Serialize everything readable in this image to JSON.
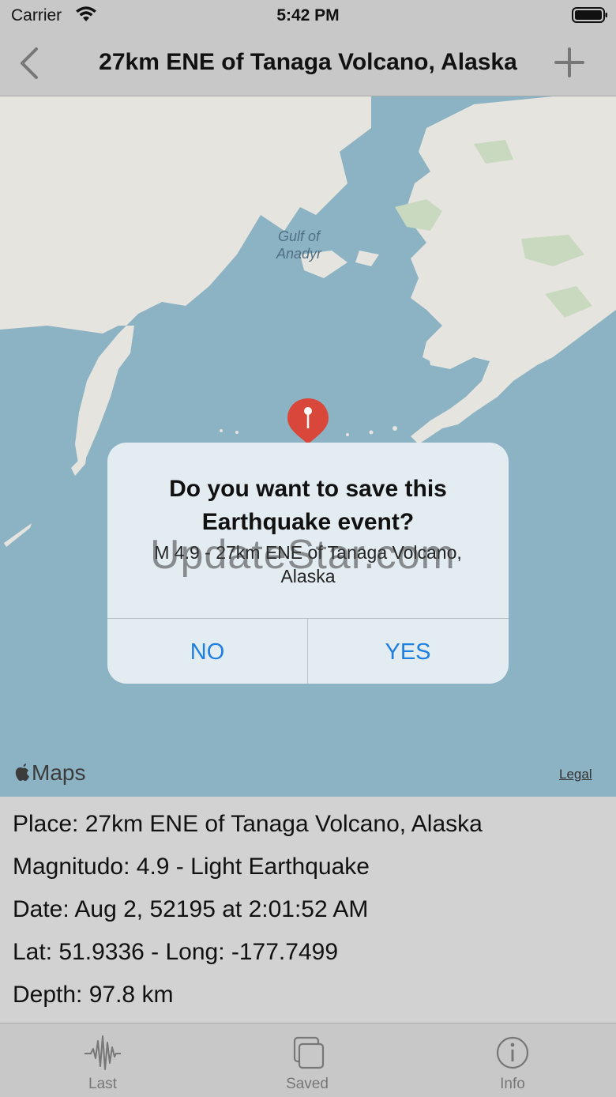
{
  "status_bar": {
    "carrier": "Carrier",
    "time": "5:42 PM"
  },
  "nav": {
    "title": "27km ENE of Tanaga Volcano, Alaska",
    "back_icon": "chevron-left-icon",
    "add_icon": "plus-icon"
  },
  "map": {
    "labels": {
      "gulf": "Gulf of\nAnadyr"
    },
    "logo": "Maps",
    "legal": "Legal",
    "colors": {
      "water": "#8cb3c4",
      "land": "#e6e4de",
      "park": "#c9d9c0",
      "pin": "#d9473a"
    }
  },
  "alert": {
    "title": "Do you want to save this Earthquake event?",
    "message": "M 4.9 - 27km ENE of Tanaga Volcano, Alaska",
    "no_label": "NO",
    "yes_label": "YES",
    "accent": "#1d7fe0"
  },
  "watermark": "UpdateStar.com",
  "details": {
    "place": "Place: 27km ENE of Tanaga Volcano, Alaska",
    "magnitude": "Magnitudo: 4.9 - Light Earthquake",
    "date": "Date:  Aug 2, 52195 at 2:01:52 AM",
    "coords": "Lat: 51.9336 - Long: -177.7499",
    "depth": "Depth:  97.8 km"
  },
  "tabs": [
    {
      "label": "Last",
      "icon": "seismograph-icon"
    },
    {
      "label": "Saved",
      "icon": "stacked-squares-icon"
    },
    {
      "label": "Info",
      "icon": "info-icon"
    }
  ]
}
